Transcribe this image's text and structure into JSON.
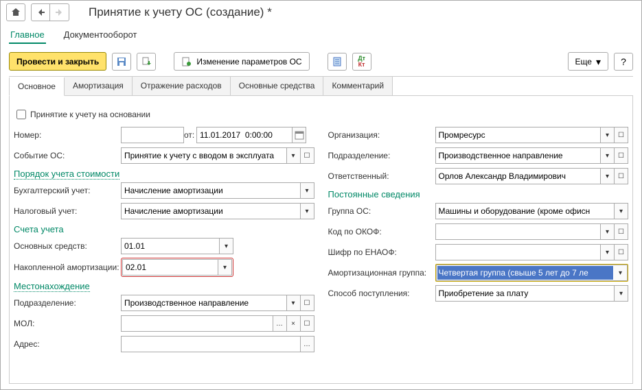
{
  "title": "Принятие к учету ОС (создание) *",
  "sections": {
    "main": "Главное",
    "docflow": "Документооборот"
  },
  "toolbar": {
    "post_close": "Провести и закрыть",
    "change_params": "Изменение параметров ОС",
    "more": "Еще",
    "help": "?"
  },
  "tabs": {
    "main": "Основное",
    "amort": "Амортизация",
    "expenses": "Отражение расходов",
    "assets": "Основные средства",
    "comment": "Комментарий"
  },
  "left": {
    "chk_basis": "Принятие к учету на основании",
    "number_label": "Номер:",
    "number_value": "",
    "from_label": "от:",
    "date_value": "11.01.2017  0:00:00",
    "event_label": "Событие ОС:",
    "event_value": "Принятие к учету с вводом в эксплуата",
    "section_cost": "Порядок учета стоимости",
    "acc_label": "Бухгалтерский учет:",
    "acc_value": "Начисление амортизации",
    "tax_label": "Налоговый учет:",
    "tax_value": "Начисление амортизации",
    "section_accounts": "Счета учета",
    "fa_acc_label": "Основных средств:",
    "fa_acc_value": "01.01",
    "dep_acc_label": "Накопленной амортизации:",
    "dep_acc_value": "02.01",
    "section_loc": "Местонахождение",
    "dept_label": "Подразделение:",
    "dept_value": "Производственное направление",
    "mol_label": "МОЛ:",
    "mol_value": "",
    "addr_label": "Адрес:",
    "addr_value": ""
  },
  "right": {
    "org_label": "Организация:",
    "org_value": "Промресурс",
    "dept_label": "Подразделение:",
    "dept_value": "Производственное направление",
    "resp_label": "Ответственный:",
    "resp_value": "Орлов Александр Владимирович",
    "section_perm": "Постоянные сведения",
    "group_label": "Группа ОС:",
    "group_value": "Машины и оборудование (кроме офисн",
    "okof_label": "Код по ОКОФ:",
    "okof_value": "",
    "enaof_label": "Шифр по ЕНАОФ:",
    "enaof_value": "",
    "amgrp_label": "Амортизационная группа:",
    "amgrp_value": "Четвертая группа (свыше 5 лет до 7 ле",
    "receipt_label": "Способ поступления:",
    "receipt_value": "Приобретение за плату"
  }
}
